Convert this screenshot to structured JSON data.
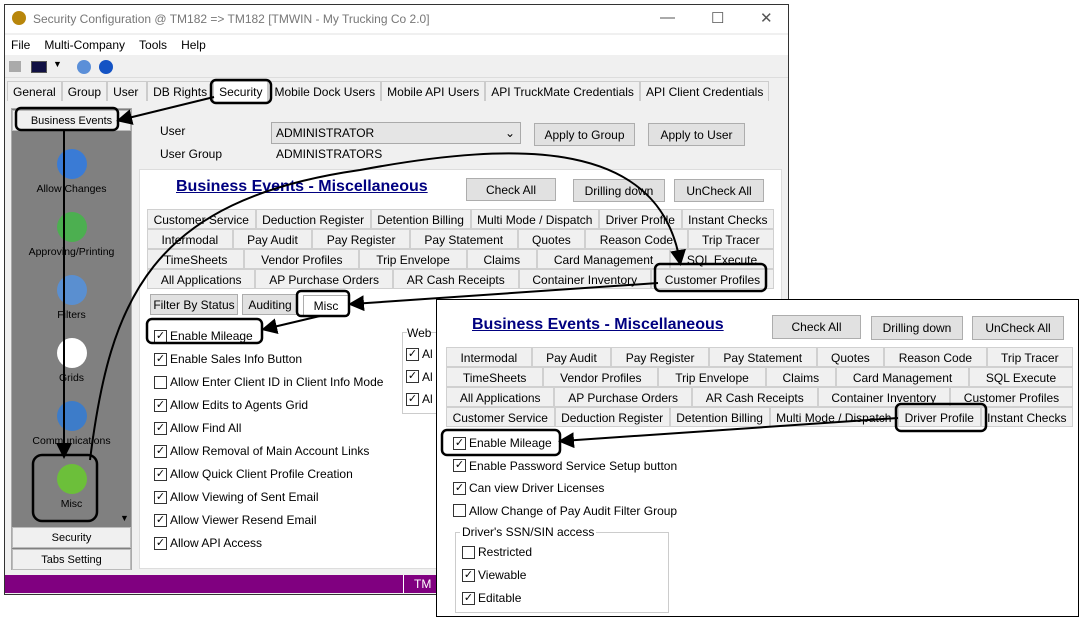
{
  "window": {
    "title": "Security Configuration @ TM182 => TM182 [TMWIN - My Trucking Co 2.0]",
    "minimize": "—",
    "maximize": "☐",
    "close": "✕"
  },
  "menu": [
    "File",
    "Multi-Company",
    "Tools",
    "Help"
  ],
  "top_tabs": [
    "General",
    "Group",
    "User",
    "DB Rights",
    "Security",
    "Mobile Dock Users",
    "Mobile API Users",
    "API TruckMate Credentials",
    "API Client Credentials"
  ],
  "sidebar": {
    "header": "Business Events",
    "items": [
      {
        "label": "Allow Changes",
        "icon": "cubes-icon",
        "color": "#3a7bd5"
      },
      {
        "label": "Approving/Printing",
        "icon": "printer-check-icon",
        "color": "#4caf50"
      },
      {
        "label": "Filters",
        "icon": "funnel-icon",
        "color": "#5a8fd0"
      },
      {
        "label": "Grids",
        "icon": "grid-icon",
        "color": "#ffffff"
      },
      {
        "label": "Communications",
        "icon": "people-icon",
        "color": "#3d7cc9"
      },
      {
        "label": "Misc",
        "icon": "question-icon",
        "color": "#6cbf3a"
      }
    ],
    "bottom": [
      "Security",
      "Tabs Setting"
    ]
  },
  "status_text": "TM",
  "user": {
    "label": "User",
    "value": "ADMINISTRATOR",
    "group_label": "User Group",
    "group_value": "ADMINISTRATORS",
    "apply_group": "Apply to Group",
    "apply_user": "Apply to User"
  },
  "panel": {
    "title": "Business Events - Miscellaneous",
    "check_all": "Check All",
    "drilling": "Drilling down",
    "uncheck_all": "UnCheck All",
    "tab_rows": [
      [
        "Customer Service",
        "Deduction Register",
        "Detention Billing",
        "Multi Mode / Dispatch",
        "Driver Profile",
        "Instant Checks"
      ],
      [
        "Intermodal",
        "Pay Audit",
        "Pay Register",
        "Pay Statement",
        "Quotes",
        "Reason Code",
        "Trip Tracer"
      ],
      [
        "TimeSheets",
        "Vendor Profiles",
        "Trip Envelope",
        "Claims",
        "Card Management",
        "SQL Execute"
      ],
      [
        "All Applications",
        "AP Purchase Orders",
        "AR Cash Receipts",
        "Container Inventory",
        "Customer Profiles"
      ]
    ],
    "sub_tabs": [
      "Filter By Status",
      "Auditing",
      "Misc"
    ],
    "options": [
      {
        "label": "Enable Mileage",
        "checked": true
      },
      {
        "label": "Enable Sales Info Button",
        "checked": true
      },
      {
        "label": "Allow Enter Client ID in Client Info Mode",
        "checked": false
      },
      {
        "label": "Allow Edits to Agents Grid",
        "checked": true
      },
      {
        "label": "Allow Find All",
        "checked": true
      },
      {
        "label": "Allow Removal of Main Account Links",
        "checked": true
      },
      {
        "label": "Allow Quick Client Profile Creation",
        "checked": true
      },
      {
        "label": "Allow Viewing of Sent Email",
        "checked": true
      },
      {
        "label": "Allow Viewer Resend Email",
        "checked": true
      },
      {
        "label": "Allow API Access",
        "checked": true
      }
    ],
    "web_group": "Web",
    "web_options": [
      "Al",
      "Al",
      "Al"
    ]
  },
  "overlay": {
    "title": "Business Events - Miscellaneous",
    "check_all": "Check All",
    "drilling": "Drilling down",
    "uncheck_all": "UnCheck All",
    "tab_rows": [
      [
        "Intermodal",
        "Pay Audit",
        "Pay Register",
        "Pay Statement",
        "Quotes",
        "Reason Code",
        "Trip Tracer"
      ],
      [
        "TimeSheets",
        "Vendor Profiles",
        "Trip Envelope",
        "Claims",
        "Card Management",
        "SQL Execute"
      ],
      [
        "All Applications",
        "AP Purchase Orders",
        "AR Cash Receipts",
        "Container Inventory",
        "Customer Profiles"
      ],
      [
        "Customer Service",
        "Deduction Register",
        "Detention Billing",
        "Multi Mode / Dispatch",
        "Driver Profile",
        "Instant Checks"
      ]
    ],
    "options": [
      {
        "label": "Enable Mileage",
        "checked": true
      },
      {
        "label": "Enable Password Service Setup button",
        "checked": true
      },
      {
        "label": "Can view Driver Licenses",
        "checked": true
      },
      {
        "label": "Allow Change of Pay Audit Filter Group",
        "checked": false
      }
    ],
    "group": "Driver's SSN/SIN access",
    "group_options": [
      {
        "label": "Restricted",
        "checked": false
      },
      {
        "label": "Viewable",
        "checked": true
      },
      {
        "label": "Editable",
        "checked": true
      }
    ]
  }
}
